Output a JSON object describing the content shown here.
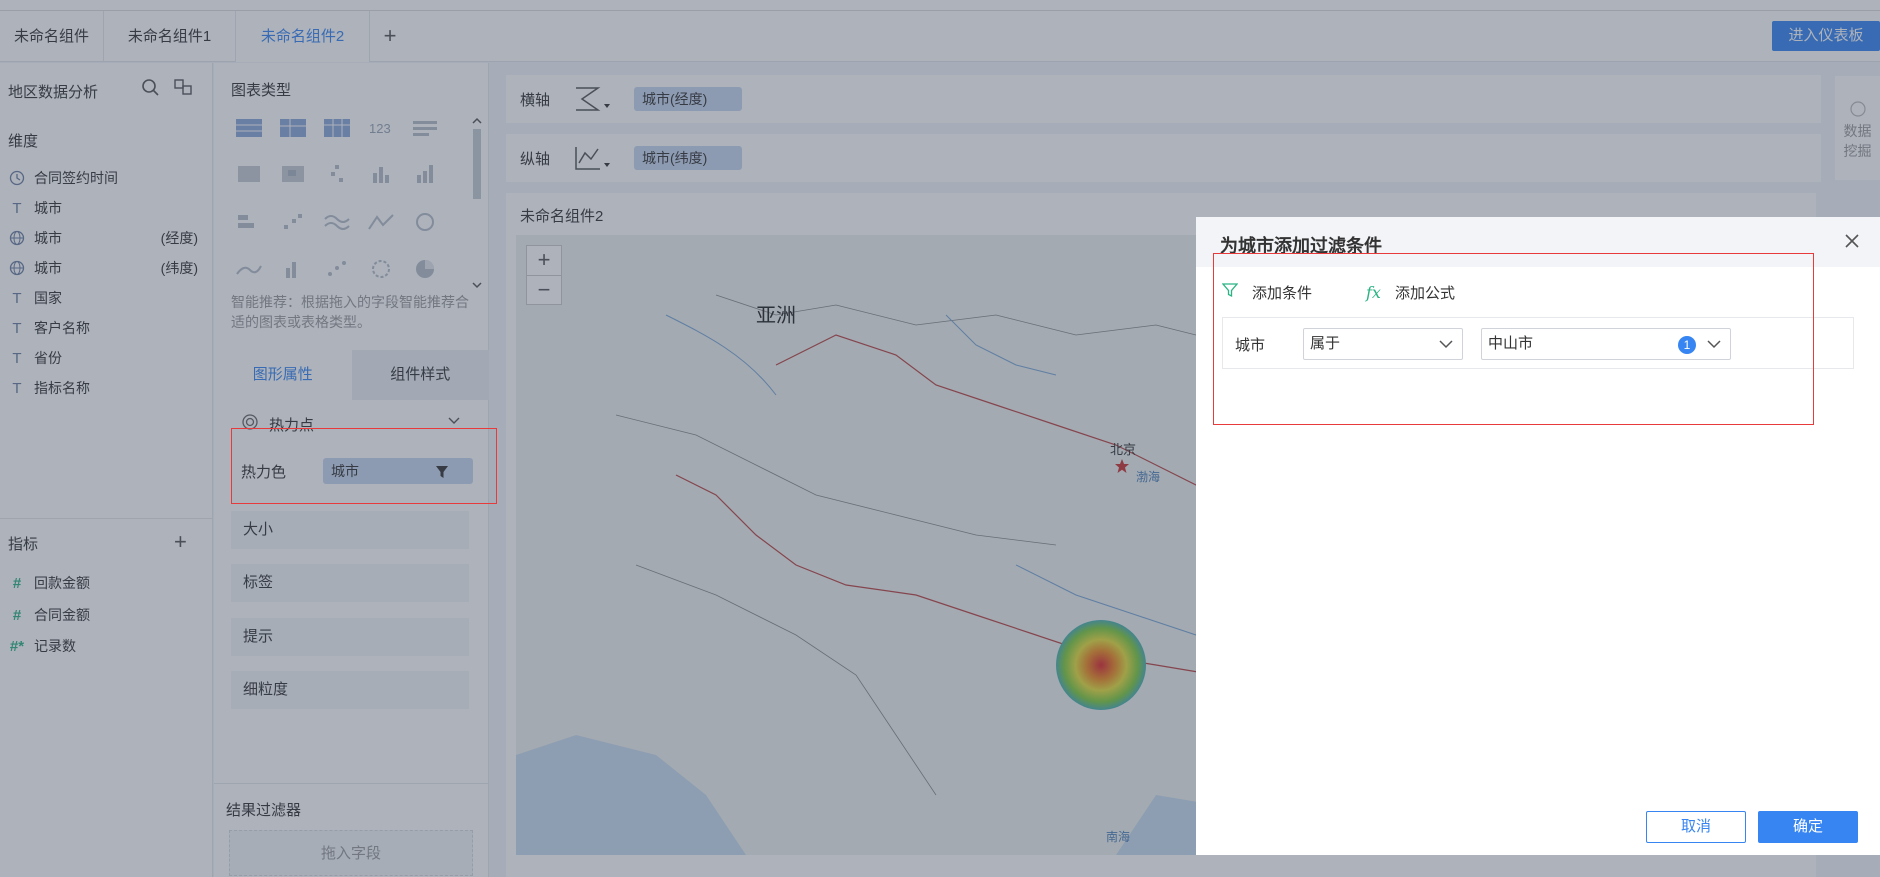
{
  "tabs": [
    "未命名组件",
    "未命名组件1",
    "未命名组件2"
  ],
  "active_tab_index": 2,
  "header": {
    "enter_dashboard": "进入仪表板"
  },
  "left": {
    "title": "地区数据分析",
    "dimension_label": "维度",
    "dimensions": [
      {
        "icon": "clock-icon",
        "label": "合同签约时间",
        "suffix": ""
      },
      {
        "icon": "text-icon",
        "label": "城市",
        "suffix": ""
      },
      {
        "icon": "globe-icon",
        "label": "城市",
        "suffix": "(经度)"
      },
      {
        "icon": "globe-icon",
        "label": "城市",
        "suffix": "(纬度)"
      },
      {
        "icon": "text-icon",
        "label": "国家",
        "suffix": ""
      },
      {
        "icon": "text-icon",
        "label": "客户名称",
        "suffix": ""
      },
      {
        "icon": "text-icon",
        "label": "省份",
        "suffix": ""
      },
      {
        "icon": "text-icon",
        "label": "指标名称",
        "suffix": ""
      }
    ],
    "measure_label": "指标",
    "measures": [
      {
        "icon": "#",
        "label": "回款金额"
      },
      {
        "icon": "#",
        "label": "合同金额"
      },
      {
        "icon": "#*",
        "label": "记录数"
      }
    ]
  },
  "middle": {
    "chart_type_label": "图表类型",
    "recommend_text": "智能推荐：根据拖入的字段智能推荐合适的图表或表格类型。",
    "prop_tabs": [
      "图形属性",
      "组件样式"
    ],
    "heat_point": "热力点",
    "heat_color_label": "热力色",
    "heat_color_field": "城市",
    "props": [
      "大小",
      "标签",
      "提示",
      "细粒度"
    ],
    "result_filter_label": "结果过滤器",
    "drop_field": "拖入字段"
  },
  "axes": {
    "x_label": "横轴",
    "x_field": "城市(经度)",
    "y_label": "纵轴",
    "y_field": "城市(纬度)"
  },
  "mining": [
    "数据",
    "挖掘"
  ],
  "chart": {
    "component_title": "未命名组件2",
    "map_labels": {
      "asia": "亚洲",
      "beijing": "北京",
      "bohai": "渤海",
      "south_sea": "南海"
    },
    "zoom_in": "+",
    "zoom_out": "−"
  },
  "dialog": {
    "title": "为城市添加过滤条件",
    "add_condition": "添加条件",
    "add_formula": "添加公式",
    "field": "城市",
    "operator": "属于",
    "value": "中山市",
    "value_count": "1",
    "cancel": "取消",
    "confirm": "确定"
  },
  "colors": {
    "accent": "#3685f2",
    "highlight": "#e83a3a",
    "green": "#2bb383"
  }
}
